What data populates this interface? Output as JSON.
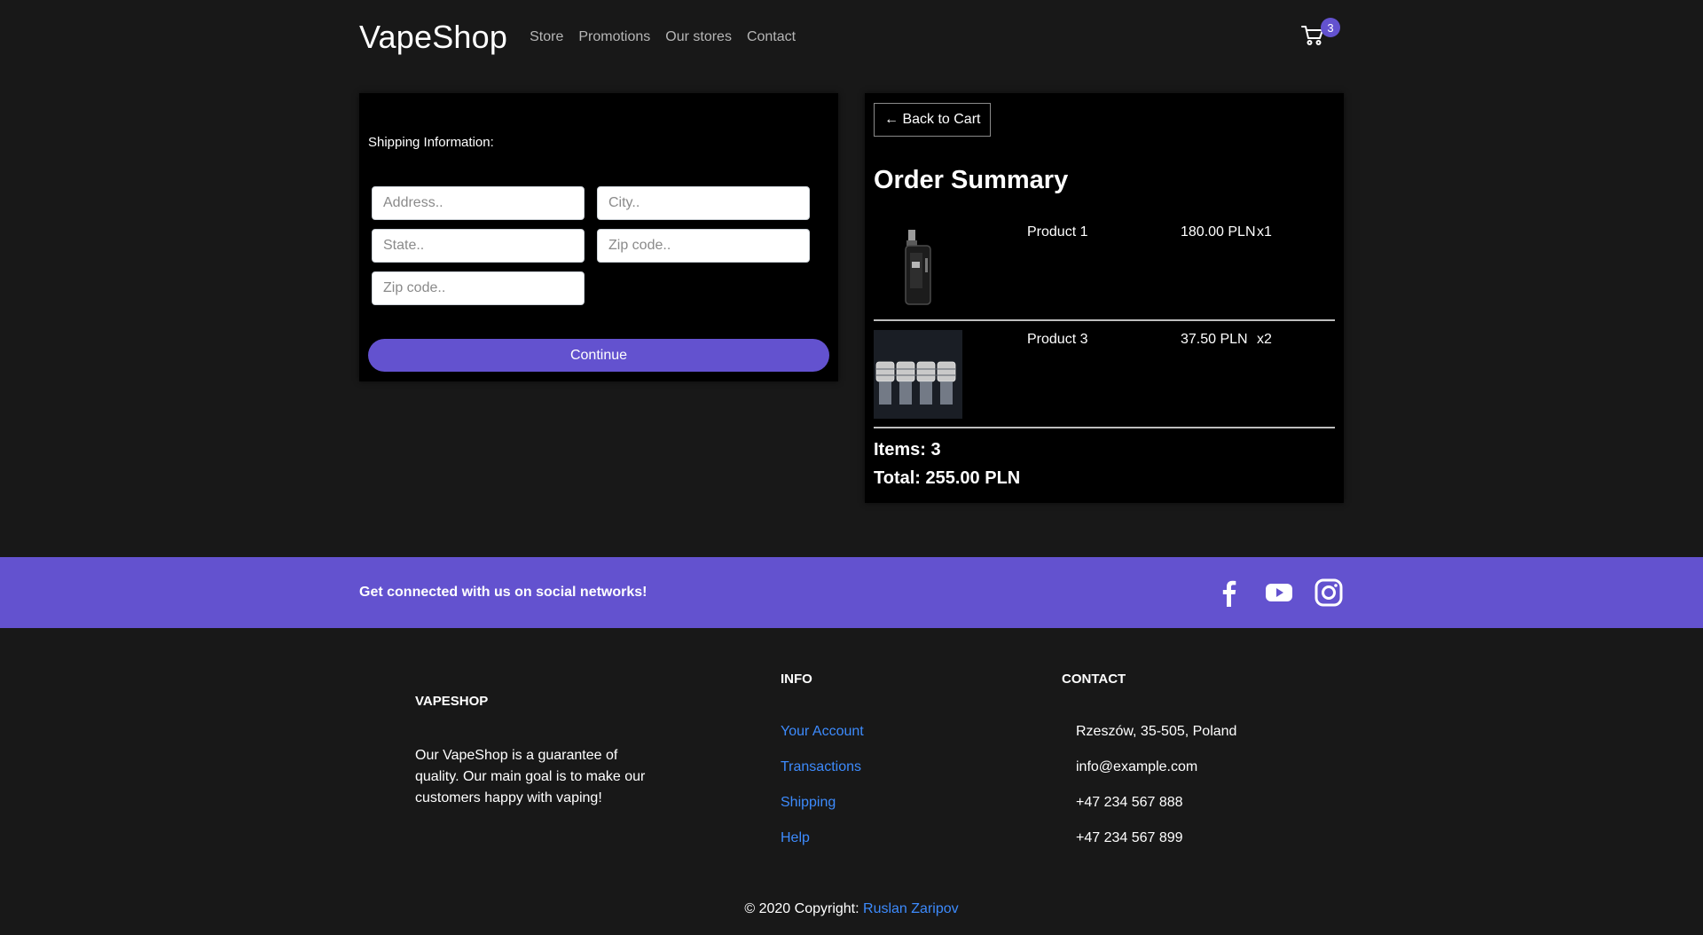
{
  "nav": {
    "brand": "VapeShop",
    "links": [
      "Store",
      "Promotions",
      "Our stores",
      "Contact"
    ],
    "cart_count": "3"
  },
  "shipping": {
    "title": "Shipping Information:",
    "fields": {
      "address": "Address..",
      "city": "City..",
      "state": "State..",
      "zip1": "Zip code..",
      "zip2": "Zip code.."
    },
    "continue_label": "Continue"
  },
  "summary": {
    "back_label": "← Back to Cart",
    "title": "Order Summary",
    "items": [
      {
        "name": "Product 1",
        "price": "180.00 PLN",
        "qty": "x1",
        "image_icon": "vape-mod-image"
      },
      {
        "name": "Product 3",
        "price": "37.50 PLN",
        "qty": "x2",
        "image_icon": "drip-tips-image"
      }
    ],
    "items_count": "Items: 3",
    "total": "Total: 255.00 PLN"
  },
  "social": {
    "text": "Get connected with us on social networks!",
    "icons": [
      "facebook-icon",
      "youtube-icon",
      "instagram-icon"
    ]
  },
  "footer": {
    "about_title": "VAPESHOP",
    "about_text": "Our VapeShop is a guarantee of quality. Our main goal is to make our customers happy with vaping!",
    "info_title": "INFO",
    "info_links": [
      "Your Account",
      "Transactions",
      "Shipping",
      "Help"
    ],
    "contact_title": "CONTACT",
    "contact_items": [
      "Rzeszów, 35-505, Poland",
      "info@example.com",
      "+47 234 567 888",
      "+47 234 567 899"
    ],
    "copyright_prefix": "© 2020 Copyright: ",
    "copyright_author": "Ruslan Zaripov"
  },
  "colors": {
    "accent": "#6352cf",
    "background": "#181818",
    "panel": "#000000",
    "link": "#3d8bfd"
  }
}
